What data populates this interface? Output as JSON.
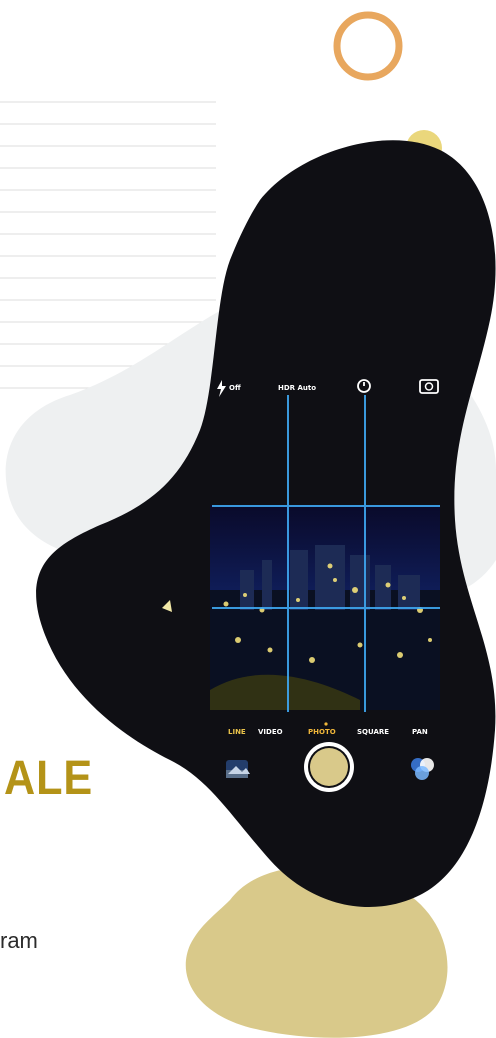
{
  "colors": {
    "background": "#ffffff",
    "rule_lines": "#e3e3e3",
    "ring_accent": "#e8a75e",
    "gold_blob": "#d9c98a",
    "yellow_blob": "#ead77c",
    "grey_blob": "#eef0f1",
    "dark_blob": "#0f0f14",
    "headline": "#b49318",
    "body_text": "#2b2b2b",
    "grid_lines": "#3fa8f2"
  },
  "headline_fragment": "ALE",
  "body_fragment": "ram",
  "camera": {
    "flash_label": "Off",
    "hdr_label": "HDR Auto",
    "timer_icon": "timer-icon",
    "switch_icon": "camera-switch-icon",
    "modes": [
      "LINE",
      "VIDEO",
      "PHOTO",
      "SQUARE",
      "PAN"
    ],
    "selected_mode": "PHOTO",
    "shutter_icon": "shutter-icon",
    "filters_icon": "filters-icon"
  }
}
